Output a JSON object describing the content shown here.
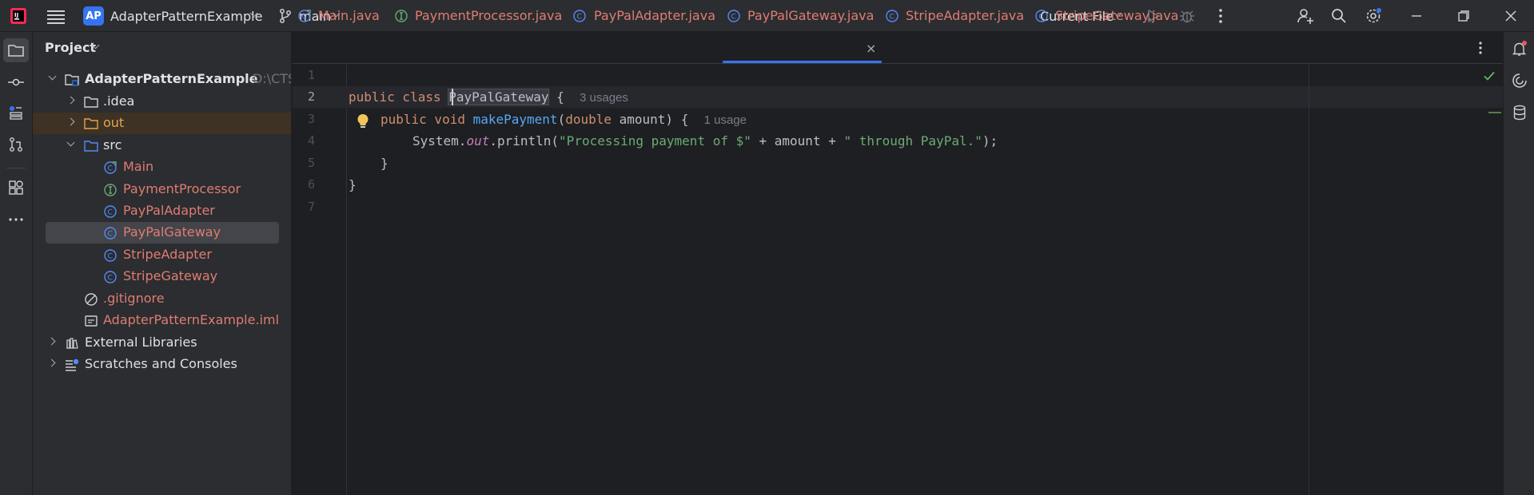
{
  "titlebar": {
    "project_badge": "AP",
    "project_name": "AdapterPatternExample",
    "branch": "main",
    "run_config": "Current File",
    "accent": "#3574f0"
  },
  "project_panel": {
    "title": "Project",
    "root": {
      "name": "AdapterPatternExample",
      "path": "D:\\CTS"
    },
    "items": [
      {
        "label": ".idea",
        "icon": "folder-icon"
      },
      {
        "label": "out",
        "icon": "folder-icon"
      },
      {
        "label": "src",
        "icon": "folder-icon"
      },
      {
        "label": "Main",
        "icon": "class-main-icon"
      },
      {
        "label": "PaymentProcessor",
        "icon": "interface-icon"
      },
      {
        "label": "PayPalAdapter",
        "icon": "class-icon"
      },
      {
        "label": "PayPalGateway",
        "icon": "class-icon"
      },
      {
        "label": "StripeAdapter",
        "icon": "class-icon"
      },
      {
        "label": "StripeGateway",
        "icon": "class-icon"
      },
      {
        "label": ".gitignore",
        "icon": "ignore-file-icon"
      },
      {
        "label": "AdapterPatternExample.iml",
        "icon": "iml-file-icon"
      },
      {
        "label": "External Libraries",
        "icon": "library-icon"
      },
      {
        "label": "Scratches and Consoles",
        "icon": "scratches-icon"
      }
    ]
  },
  "tabs": [
    {
      "label": "Main.java"
    },
    {
      "label": "PaymentProcessor.java"
    },
    {
      "label": "PayPalAdapter.java"
    },
    {
      "label": "PayPalGateway.java",
      "active": true
    },
    {
      "label": "StripeAdapter.java"
    },
    {
      "label": "StripeGateway.java"
    }
  ],
  "editor": {
    "line_numbers": [
      "1",
      "2",
      "3",
      "4",
      "5",
      "6",
      "7"
    ],
    "current_line": "2",
    "code": {
      "l2_kw": "public class ",
      "l2_name": "PayPalGateway",
      "l2_brace": " {",
      "l2_hint": "3 usages",
      "l3_kw": "public void ",
      "l3_fn": "makePayment",
      "l3_args_open": "(",
      "l3_type": "double",
      "l3_args_rest": " amount) {",
      "l3_hint": "1 usage",
      "l4_a": "System.",
      "l4_out": "out",
      "l4_b": ".println(",
      "l4_str1": "\"Processing payment of $\"",
      "l4_c": " + amount + ",
      "l4_str2": "\" through PayPal.\"",
      "l4_d": ");",
      "l5": "}",
      "l6": "}"
    }
  }
}
